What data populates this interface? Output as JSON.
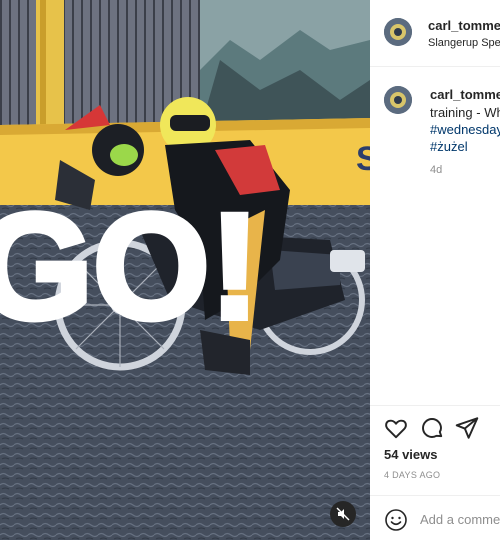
{
  "post": {
    "author": "carl_tommer",
    "location": "Slangerup Spee",
    "caption_text": "training - Wh",
    "hashtags": [
      "#wednesday",
      "#żużel"
    ],
    "caption_age": "4d",
    "overlay_text": "GO!",
    "views": "54 views",
    "posted_ago": "4 DAYS AGO",
    "comment_placeholder": "Add a commen"
  },
  "icons": {
    "like": "heart-icon",
    "comment": "comment-bubble-icon",
    "share": "paper-plane-icon",
    "mute": "speaker-muted-icon",
    "emoji": "smiley-icon"
  },
  "colors": {
    "link": "#00376b",
    "muted_text": "#8e8e8e",
    "text": "#262626",
    "divider": "#efefef",
    "banner_yellow": "#f3c84a"
  }
}
